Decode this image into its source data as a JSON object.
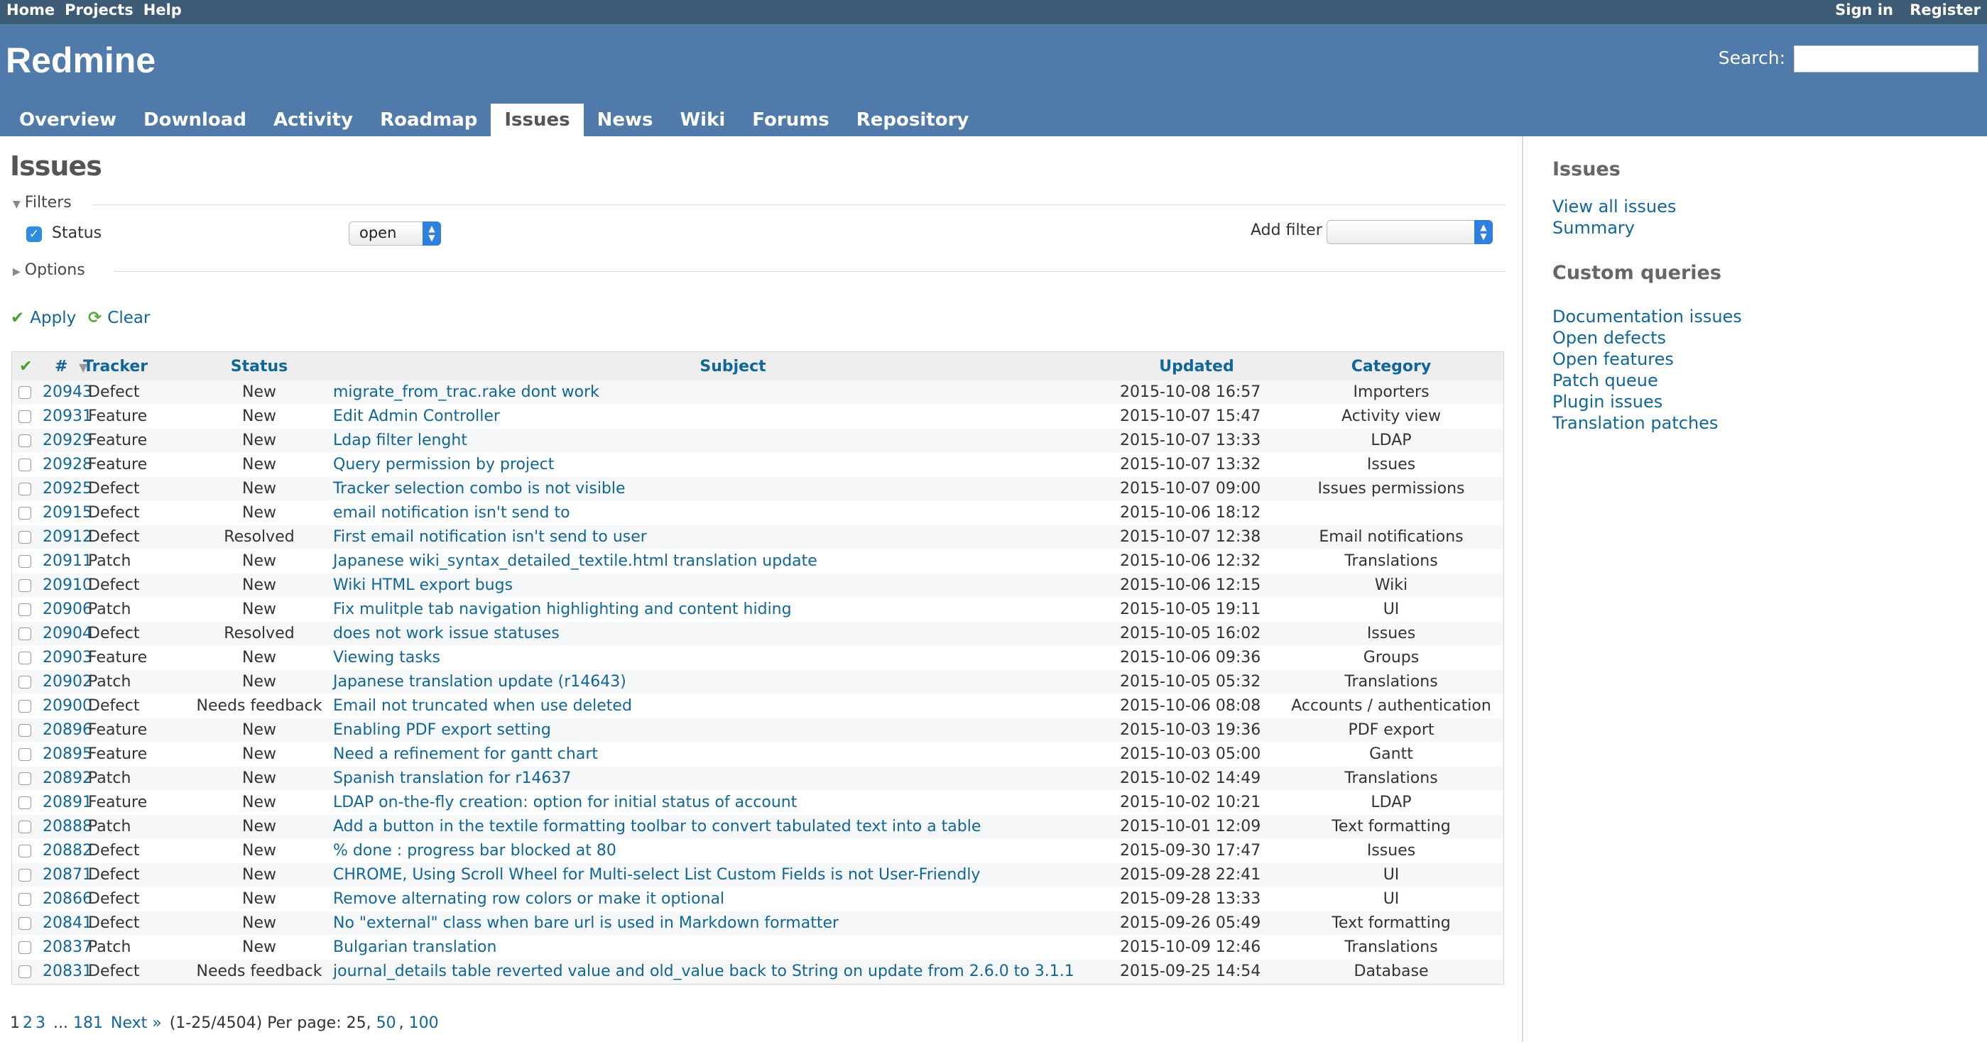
{
  "top_menu": {
    "left": [
      "Home",
      "Projects",
      "Help"
    ],
    "sign_in": "Sign in",
    "register": "Register"
  },
  "header": {
    "title": "Redmine",
    "search_label": "Search:",
    "search_value": ""
  },
  "main_menu": {
    "tabs": [
      "Overview",
      "Download",
      "Activity",
      "Roadmap",
      "Issues",
      "News",
      "Wiki",
      "Forums",
      "Repository"
    ],
    "selected": "Issues"
  },
  "content": {
    "title": "Issues",
    "filters_legend": "Filters",
    "filter_status_label": "Status",
    "filter_status_value": "open",
    "add_filter_label": "Add filter",
    "add_filter_value": "",
    "options_legend": "Options",
    "apply_label": "Apply",
    "clear_label": "Clear"
  },
  "table": {
    "headers": {
      "id": "#",
      "tracker": "Tracker",
      "status": "Status",
      "subject": "Subject",
      "updated": "Updated",
      "category": "Category"
    },
    "rows": [
      {
        "id": "20943",
        "tracker": "Defect",
        "status": "New",
        "subject": "migrate_from_trac.rake dont work",
        "updated": "2015-10-08 16:57",
        "category": "Importers"
      },
      {
        "id": "20931",
        "tracker": "Feature",
        "status": "New",
        "subject": "Edit Admin Controller",
        "updated": "2015-10-07 15:47",
        "category": "Activity view"
      },
      {
        "id": "20929",
        "tracker": "Feature",
        "status": "New",
        "subject": "Ldap filter lenght",
        "updated": "2015-10-07 13:33",
        "category": "LDAP"
      },
      {
        "id": "20928",
        "tracker": "Feature",
        "status": "New",
        "subject": "Query permission by project",
        "updated": "2015-10-07 13:32",
        "category": "Issues"
      },
      {
        "id": "20925",
        "tracker": "Defect",
        "status": "New",
        "subject": "Tracker selection combo is not visible",
        "updated": "2015-10-07 09:00",
        "category": "Issues permissions"
      },
      {
        "id": "20915",
        "tracker": "Defect",
        "status": "New",
        "subject": "email notification isn't send to",
        "updated": "2015-10-06 18:12",
        "category": ""
      },
      {
        "id": "20912",
        "tracker": "Defect",
        "status": "Resolved",
        "subject": "First email notification isn't send to user",
        "updated": "2015-10-07 12:38",
        "category": "Email notifications"
      },
      {
        "id": "20911",
        "tracker": "Patch",
        "status": "New",
        "subject": "Japanese wiki_syntax_detailed_textile.html translation update",
        "updated": "2015-10-06 12:32",
        "category": "Translations"
      },
      {
        "id": "20910",
        "tracker": "Defect",
        "status": "New",
        "subject": "Wiki HTML export bugs",
        "updated": "2015-10-06 12:15",
        "category": "Wiki"
      },
      {
        "id": "20906",
        "tracker": "Patch",
        "status": "New",
        "subject": "Fix mulitple tab navigation highlighting and content hiding",
        "updated": "2015-10-05 19:11",
        "category": "UI"
      },
      {
        "id": "20904",
        "tracker": "Defect",
        "status": "Resolved",
        "subject": "does not work issue statuses",
        "updated": "2015-10-05 16:02",
        "category": "Issues"
      },
      {
        "id": "20903",
        "tracker": "Feature",
        "status": "New",
        "subject": "Viewing tasks",
        "updated": "2015-10-06 09:36",
        "category": "Groups"
      },
      {
        "id": "20902",
        "tracker": "Patch",
        "status": "New",
        "subject": "Japanese translation update (r14643)",
        "updated": "2015-10-05 05:32",
        "category": "Translations"
      },
      {
        "id": "20900",
        "tracker": "Defect",
        "status": "Needs feedback",
        "subject": "Email not truncated when use deleted",
        "updated": "2015-10-06 08:08",
        "category": "Accounts / authentication"
      },
      {
        "id": "20896",
        "tracker": "Feature",
        "status": "New",
        "subject": "Enabling PDF export setting",
        "updated": "2015-10-03 19:36",
        "category": "PDF export"
      },
      {
        "id": "20895",
        "tracker": "Feature",
        "status": "New",
        "subject": "Need a refinement for gantt chart",
        "updated": "2015-10-03 05:00",
        "category": "Gantt"
      },
      {
        "id": "20892",
        "tracker": "Patch",
        "status": "New",
        "subject": "Spanish translation for r14637",
        "updated": "2015-10-02 14:49",
        "category": "Translations"
      },
      {
        "id": "20891",
        "tracker": "Feature",
        "status": "New",
        "subject": "LDAP on-the-fly creation: option for initial status of account",
        "updated": "2015-10-02 10:21",
        "category": "LDAP"
      },
      {
        "id": "20888",
        "tracker": "Patch",
        "status": "New",
        "subject": "Add a button in the textile formatting toolbar to convert tabulated text into a table",
        "updated": "2015-10-01 12:09",
        "category": "Text formatting"
      },
      {
        "id": "20882",
        "tracker": "Defect",
        "status": "New",
        "subject": "% done : progress bar blocked at 80",
        "updated": "2015-09-30 17:47",
        "category": "Issues"
      },
      {
        "id": "20871",
        "tracker": "Defect",
        "status": "New",
        "subject": "CHROME, Using Scroll Wheel for Multi-select List Custom Fields is not User-Friendly",
        "updated": "2015-09-28 22:41",
        "category": "UI"
      },
      {
        "id": "20866",
        "tracker": "Defect",
        "status": "New",
        "subject": "Remove alternating row colors or make it optional",
        "updated": "2015-09-28 13:33",
        "category": "UI"
      },
      {
        "id": "20841",
        "tracker": "Defect",
        "status": "New",
        "subject": "No \"external\" class when bare url is used in Markdown formatter",
        "updated": "2015-09-26 05:49",
        "category": "Text formatting"
      },
      {
        "id": "20837",
        "tracker": "Patch",
        "status": "New",
        "subject": "Bulgarian translation",
        "updated": "2015-10-09 12:46",
        "category": "Translations"
      },
      {
        "id": "20831",
        "tracker": "Defect",
        "status": "Needs feedback",
        "subject": "journal_details table reverted value and old_value back to String on update from 2.6.0 to 3.1.1",
        "updated": "2015-09-25 14:54",
        "category": "Database"
      }
    ]
  },
  "pagination": {
    "pages": [
      "1",
      "2",
      "3"
    ],
    "ellipsis": "...",
    "last_page": "181",
    "next": "Next »",
    "range": "(1-25/4504)",
    "per_page_label": "Per page:",
    "per_page_current": "25",
    "per_page_options": [
      "50",
      "100"
    ]
  },
  "sidebar": {
    "issues_heading": "Issues",
    "view_all": "View all issues",
    "summary": "Summary",
    "custom_queries_heading": "Custom queries",
    "queries": [
      "Documentation issues",
      "Open defects",
      "Open features",
      "Patch queue",
      "Plugin issues",
      "Translation patches"
    ]
  },
  "colors": {
    "top_menu_bg": "#3E5B76",
    "header_bg": "#507AAA",
    "link": "#116699",
    "row_alt": "#f6f7f8"
  }
}
